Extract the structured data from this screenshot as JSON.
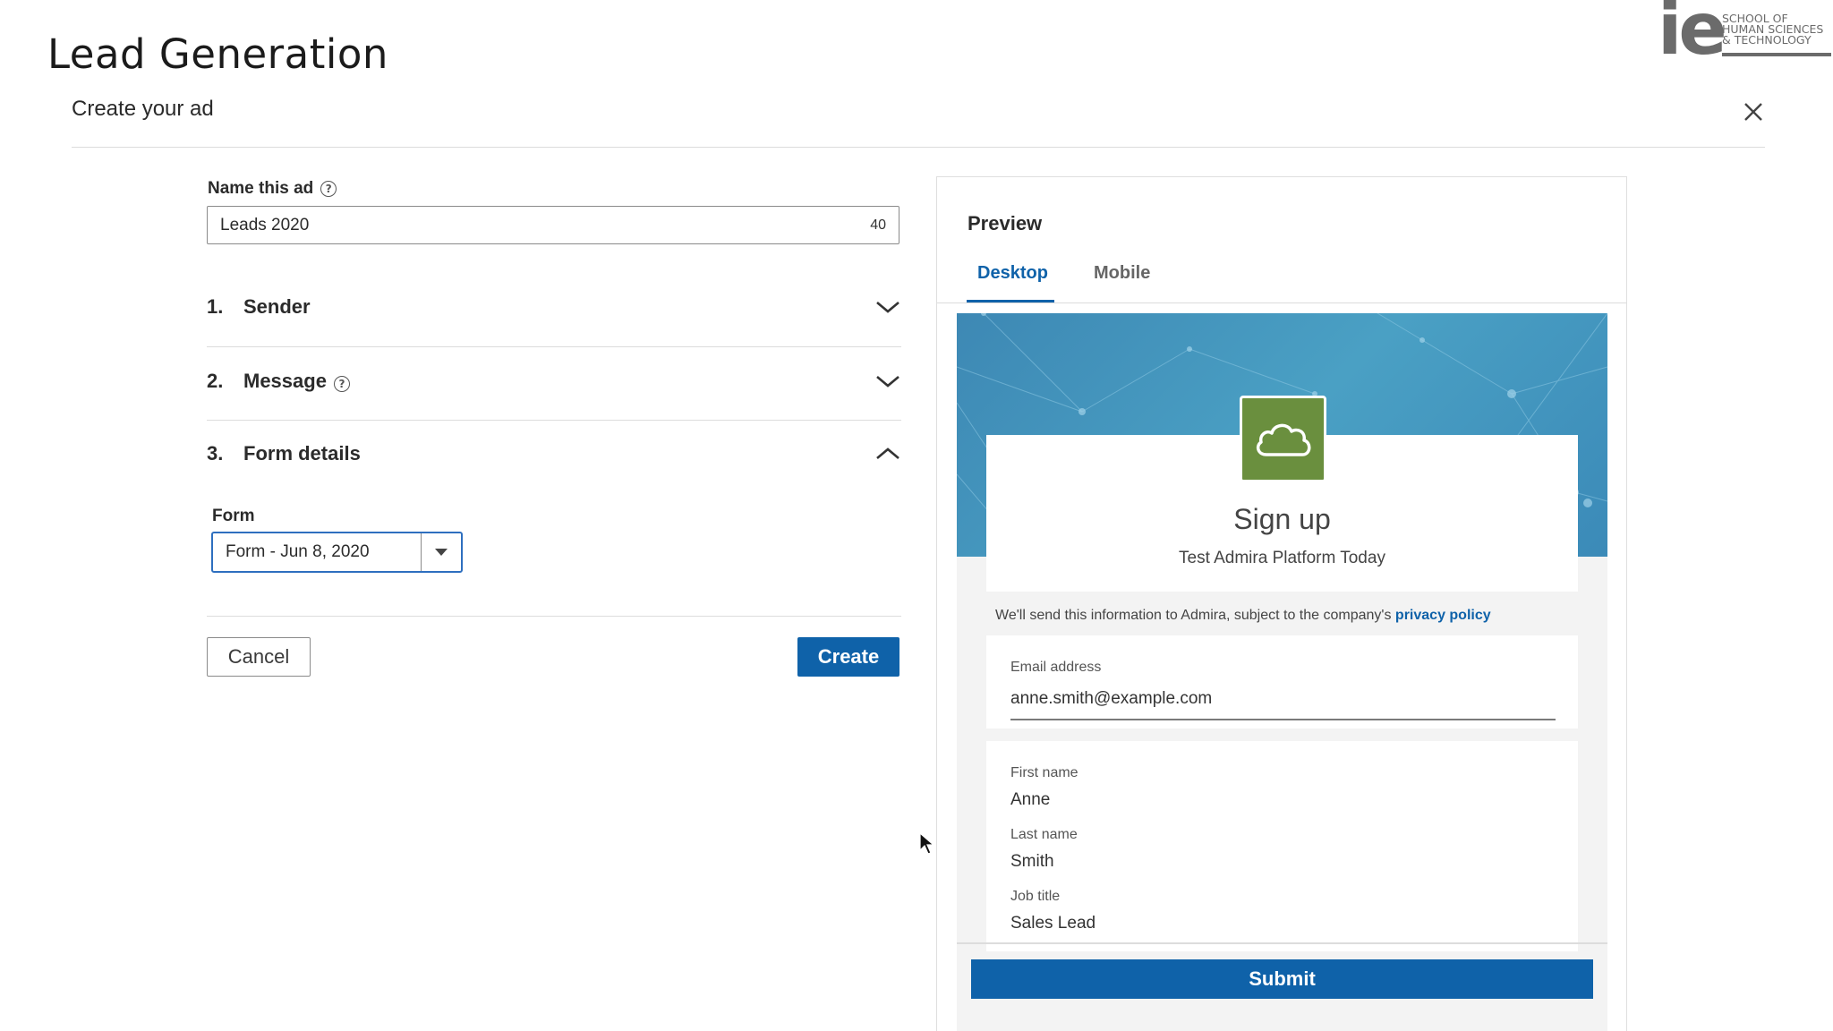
{
  "slide": {
    "title": "Lead Generation",
    "logo": {
      "mark": "ie",
      "text": "SCHOOL OF\nHUMAN SCIENCES\n& TECHNOLOGY"
    }
  },
  "modal": {
    "title": "Create your ad",
    "close_icon": "close-icon"
  },
  "form": {
    "name_label": "Name this ad",
    "name_value": "Leads 2020",
    "char_count": "40",
    "sections": [
      {
        "num": "1.",
        "label": "Sender",
        "expanded": false,
        "has_help": false
      },
      {
        "num": "2.",
        "label": "Message",
        "expanded": false,
        "has_help": true
      },
      {
        "num": "3.",
        "label": "Form details",
        "expanded": true,
        "has_help": false
      }
    ],
    "form_label": "Form",
    "form_select_value": "Form - Jun 8, 2020",
    "cancel_label": "Cancel",
    "create_label": "Create"
  },
  "preview": {
    "title": "Preview",
    "tabs": [
      "Desktop",
      "Mobile"
    ],
    "active_tab": "Desktop",
    "signup_title": "Sign up",
    "signup_subtitle": "Test Admira Platform Today",
    "privacy_text": "We'll send this information to Admira, subject to the company's",
    "privacy_link": "privacy policy",
    "fields": [
      {
        "label": "Email address",
        "value": "anne.smith@example.com"
      },
      {
        "label": "First name",
        "value": "Anne"
      },
      {
        "label": "Last name",
        "value": "Smith"
      },
      {
        "label": "Job title",
        "value": "Sales Lead"
      }
    ],
    "submit_label": "Submit"
  },
  "colors": {
    "accent": "#0f62a9",
    "app_logo": "#6a8f3e",
    "banner": "#4196bf"
  }
}
